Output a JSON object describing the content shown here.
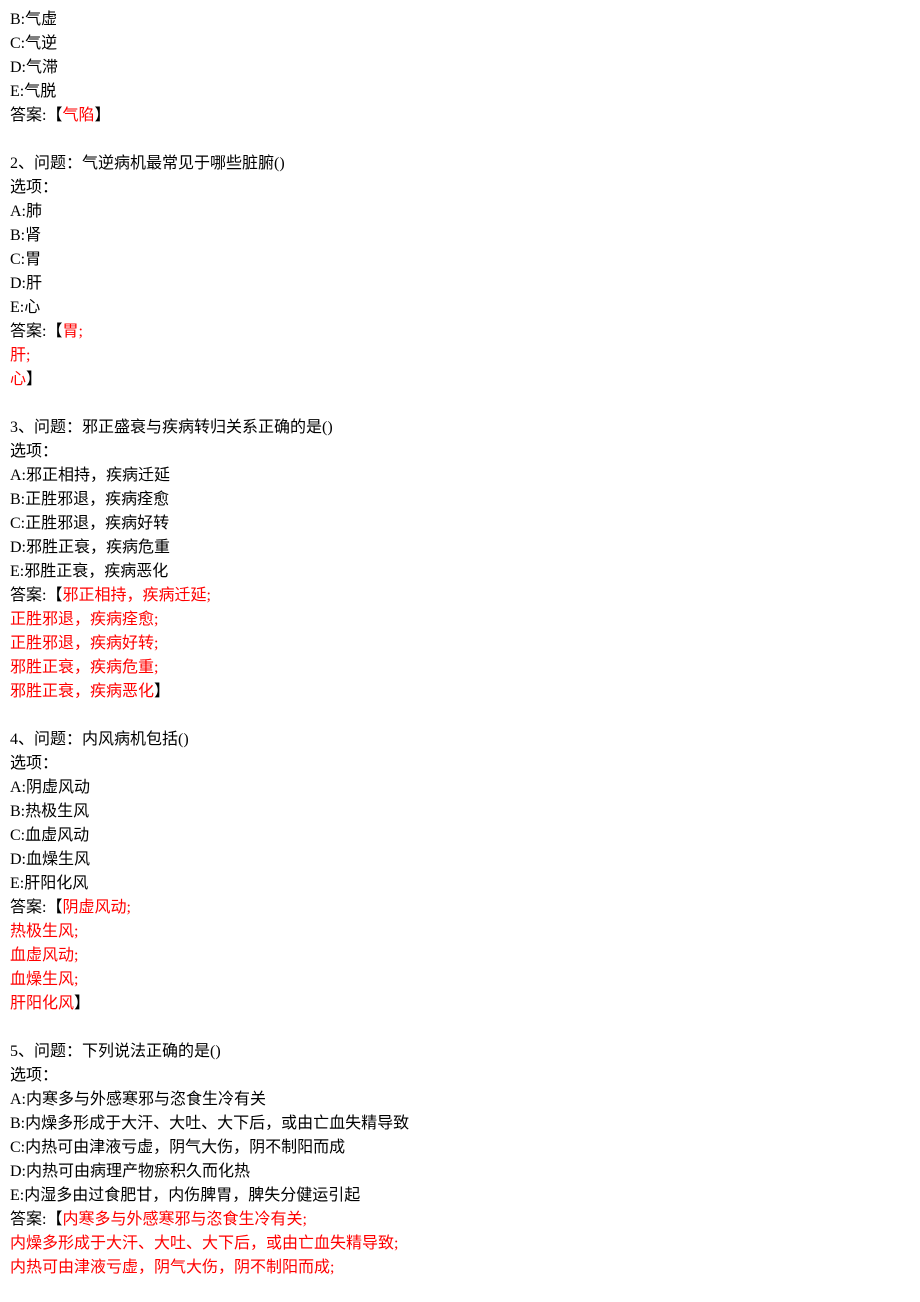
{
  "q1_tail": {
    "optB": "B:气虚",
    "optC": "C:气逆",
    "optD": "D:气滞",
    "optE": "E:气脱",
    "ans_prefix": "答案:【",
    "ans_text": "气陷",
    "ans_suffix": "】"
  },
  "q2": {
    "prompt": "2、问题：气逆病机最常见于哪些脏腑()",
    "opt_label": "选项：",
    "optA": "A:肺",
    "optB": "B:肾",
    "optC": "C:胃",
    "optD": "D:肝",
    "optE": "E:心",
    "ans_prefix": "答案:【",
    "ans1": "胃;",
    "ans2": "肝;",
    "ans3": "心",
    "ans_suffix": "】"
  },
  "q3": {
    "prompt": "3、问题：邪正盛衰与疾病转归关系正确的是()",
    "opt_label": "选项：",
    "optA": "A:邪正相持，疾病迁延",
    "optB": "B:正胜邪退，疾病痊愈",
    "optC": "C:正胜邪退，疾病好转",
    "optD": "D:邪胜正衰，疾病危重",
    "optE": "E:邪胜正衰，疾病恶化",
    "ans_prefix": "答案:【",
    "ans1": "邪正相持，疾病迁延;",
    "ans2": "正胜邪退，疾病痊愈;",
    "ans3": "正胜邪退，疾病好转;",
    "ans4": "邪胜正衰，疾病危重;",
    "ans5": "邪胜正衰，疾病恶化",
    "ans_suffix": "】"
  },
  "q4": {
    "prompt": "4、问题：内风病机包括()",
    "opt_label": "选项：",
    "optA": "A:阴虚风动",
    "optB": "B:热极生风",
    "optC": "C:血虚风动",
    "optD": "D:血燥生风",
    "optE": "E:肝阳化风",
    "ans_prefix": "答案:【",
    "ans1": "阴虚风动;",
    "ans2": "热极生风;",
    "ans3": "血虚风动;",
    "ans4": "血燥生风;",
    "ans5": "肝阳化风",
    "ans_suffix": "】"
  },
  "q5": {
    "prompt": "5、问题：下列说法正确的是()",
    "opt_label": "选项：",
    "optA": "A:内寒多与外感寒邪与恣食生冷有关",
    "optB": "B:内燥多形成于大汗、大吐、大下后，或由亡血失精导致",
    "optC": "C:内热可由津液亏虚，阴气大伤，阴不制阳而成",
    "optD": "D:内热可由病理产物瘀积久而化热",
    "optE": "E:内湿多由过食肥甘，内伤脾胃，脾失分健运引起",
    "ans_prefix": "答案:【",
    "ans1": "内寒多与外感寒邪与恣食生冷有关;",
    "ans2": "内燥多形成于大汗、大吐、大下后，或由亡血失精导致;",
    "ans3": "内热可由津液亏虚，阴气大伤，阴不制阳而成;"
  }
}
